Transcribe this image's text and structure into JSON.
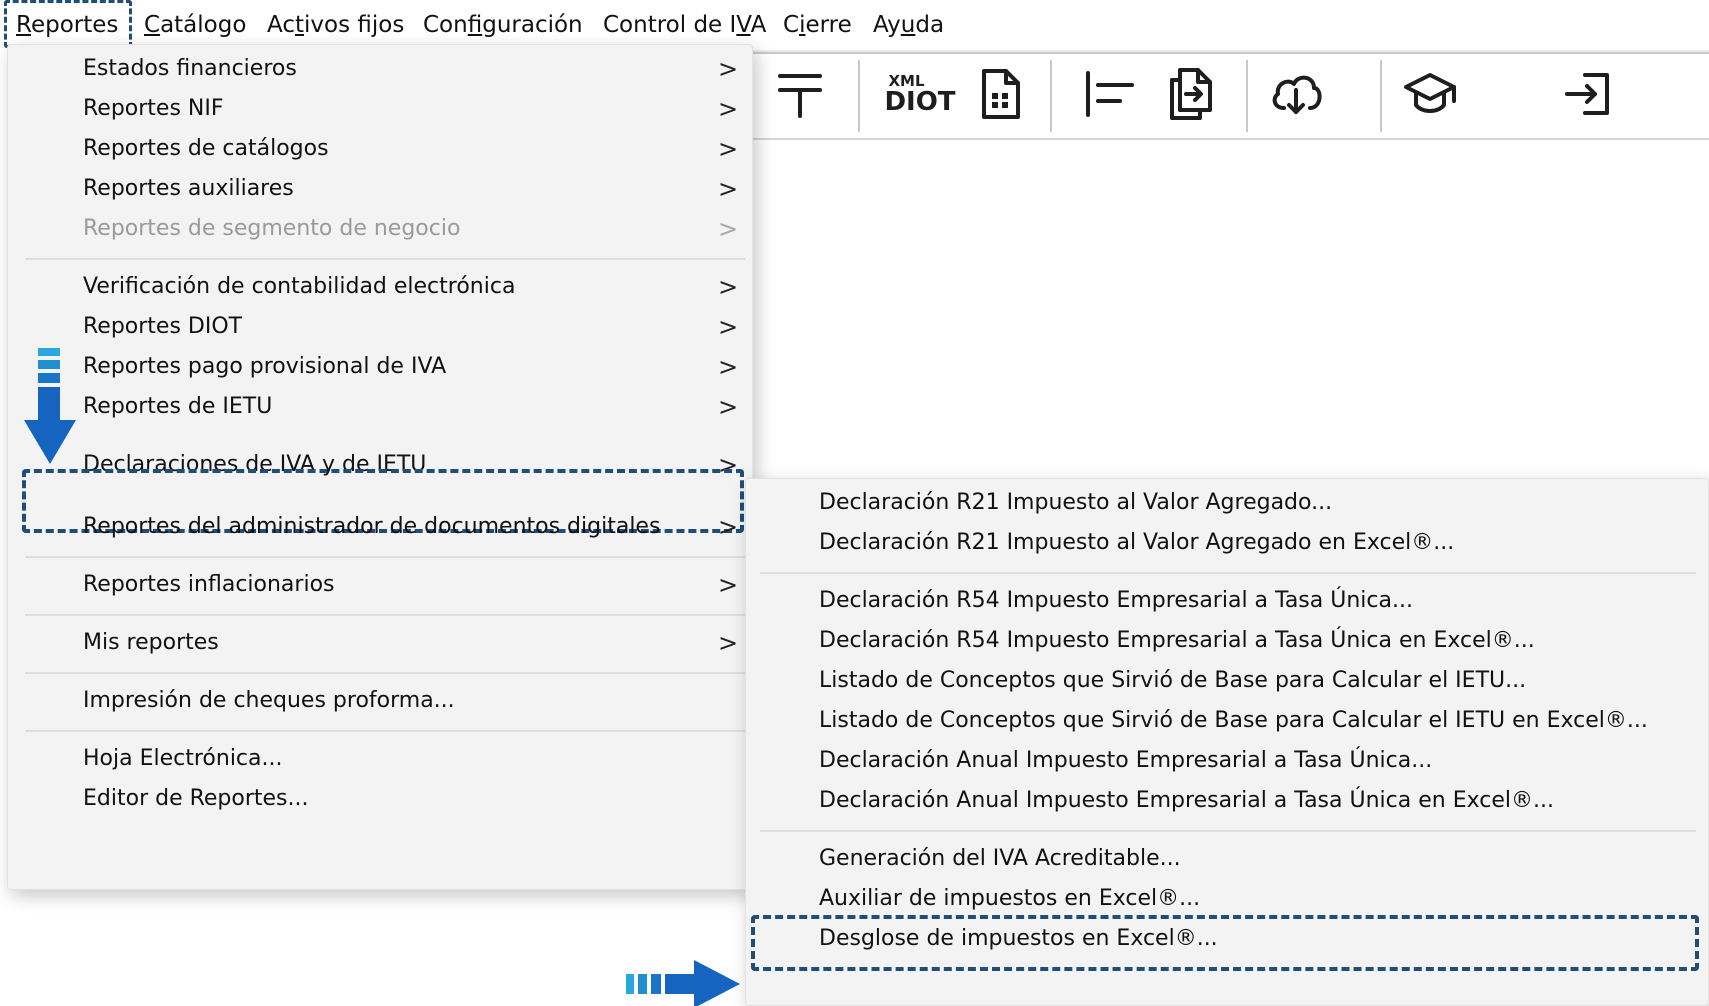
{
  "menubar": {
    "items": [
      {
        "pre": "",
        "ul": "R",
        "post": "eportes"
      },
      {
        "pre": "",
        "ul": "C",
        "post": "atálogo"
      },
      {
        "pre": "Ac",
        "ul": "t",
        "post": "ivos fijos"
      },
      {
        "pre": "Con",
        "ul": "f",
        "post": "iguración"
      },
      {
        "pre": "Control de I",
        "ul": "V",
        "post": "A"
      },
      {
        "pre": "C",
        "ul": "i",
        "post": "erre"
      },
      {
        "pre": "Ay",
        "ul": "u",
        "post": "da"
      }
    ]
  },
  "toolbar": {
    "icons": [
      "tax-symbol-icon",
      "xml-diot-icon",
      "document-grid-icon",
      "align-left-icon",
      "document-export-icon",
      "cloud-download-icon",
      "graduation-cap-icon",
      "sign-in-icon"
    ],
    "diot_small": "XML",
    "diot_big": "DIOT"
  },
  "main_menu": {
    "items": [
      {
        "label": "Estados financieros",
        "chevron": ">"
      },
      {
        "label": "Reportes NIF",
        "chevron": ">"
      },
      {
        "label": "Reportes de catálogos",
        "chevron": ">"
      },
      {
        "label": "Reportes auxiliares",
        "chevron": ">"
      },
      {
        "label": "Reportes de segmento de negocio",
        "chevron": ">",
        "disabled": true
      },
      {
        "label": "Verificación de contabilidad electrónica",
        "chevron": ">"
      },
      {
        "label": "Reportes DIOT",
        "chevron": ">"
      },
      {
        "label": "Reportes pago provisional de IVA",
        "chevron": ">"
      },
      {
        "label": "Reportes de IETU",
        "chevron": ">"
      },
      {
        "label": "Declaraciones de IVA y de IETU",
        "chevron": ">",
        "highlighted": true
      },
      {
        "label": "Reportes del administrador de documentos digitales",
        "chevron": ">"
      },
      {
        "label": "Reportes inflacionarios",
        "chevron": ">"
      },
      {
        "label": "Mis reportes",
        "chevron": ">"
      },
      {
        "label": "Impresión de cheques proforma..."
      },
      {
        "label": "Hoja Electrónica..."
      },
      {
        "label": "Editor de Reportes..."
      }
    ]
  },
  "submenu": {
    "items": [
      {
        "label": "Declaración R21 Impuesto al Valor Agregado..."
      },
      {
        "label": "Declaración R21 Impuesto al Valor Agregado en Excel®..."
      },
      {
        "label": "Declaración R54 Impuesto Empresarial a Tasa Única..."
      },
      {
        "label": "Declaración R54 Impuesto Empresarial a Tasa Única en Excel®..."
      },
      {
        "label": "Listado de Conceptos que Sirvió de Base para Calcular el IETU..."
      },
      {
        "label": "Listado de Conceptos que Sirvió de Base para Calcular el IETU en Excel®..."
      },
      {
        "label": "Declaración Anual Impuesto Empresarial a Tasa Única..."
      },
      {
        "label": "Declaración Anual Impuesto Empresarial a Tasa Única en Excel®..."
      },
      {
        "label": "Generación del IVA Acreditable..."
      },
      {
        "label": "Auxiliar de impuestos en Excel®..."
      },
      {
        "label": "Desglose de impuestos en Excel®...",
        "highlighted": true
      }
    ]
  },
  "colors": {
    "annotation_dark": "#1f4e79",
    "annotation_arrow": "#1565c0",
    "annotation_light": "#29a8e0",
    "menu_bg": "#f3f3f3"
  }
}
